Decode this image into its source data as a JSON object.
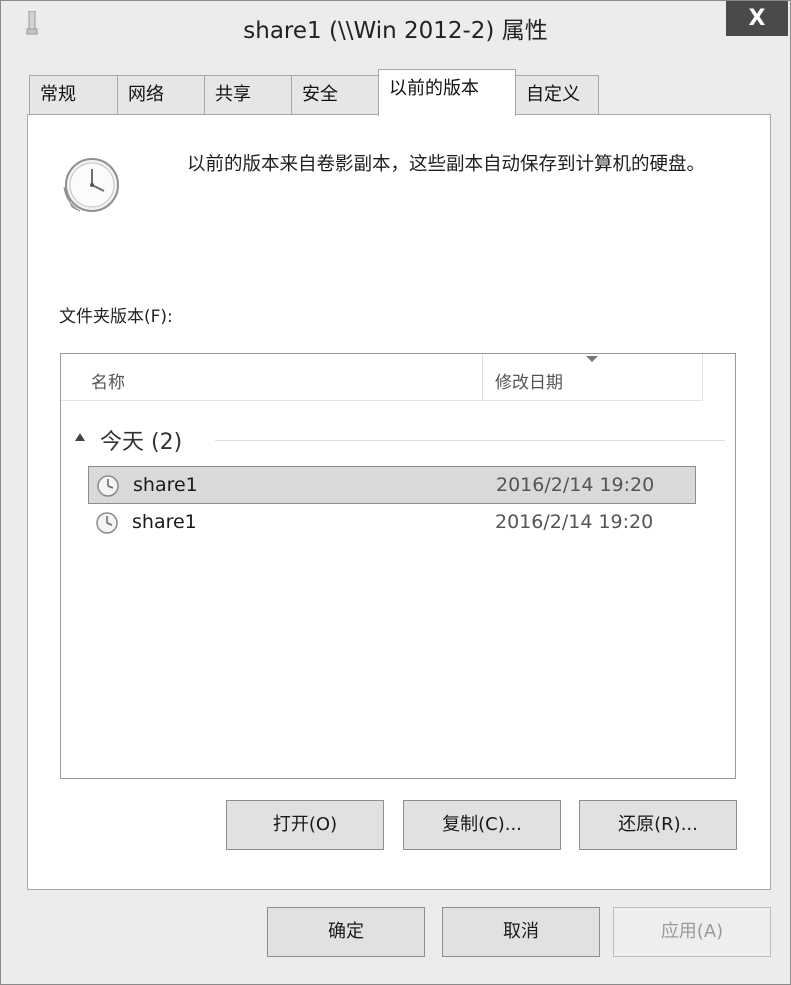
{
  "window": {
    "title": "share1 (\\\\Win 2012-2) 属性",
    "close_label": "X"
  },
  "tabs": [
    {
      "label": "常规"
    },
    {
      "label": "网络"
    },
    {
      "label": "共享"
    },
    {
      "label": "安全"
    },
    {
      "label": "以前的版本"
    },
    {
      "label": "自定义"
    }
  ],
  "active_tab": "以前的版本",
  "description": "以前的版本来自卷影副本，这些副本自动保存到计算机的硬盘。",
  "versions_label": "文件夹版本(F):",
  "list": {
    "columns": [
      {
        "label": "名称"
      },
      {
        "label": "修改日期"
      }
    ],
    "groups": [
      {
        "title": "今天 (2)",
        "rows": [
          {
            "name": "share1",
            "date": "2016/2/14 19:20",
            "selected": true
          },
          {
            "name": "share1",
            "date": "2016/2/14 19:20",
            "selected": false
          }
        ]
      }
    ]
  },
  "actions": {
    "open": "打开(O)",
    "copy": "复制(C)...",
    "restore": "还原(R)..."
  },
  "footer": {
    "ok": "确定",
    "cancel": "取消",
    "apply": "应用(A)"
  }
}
